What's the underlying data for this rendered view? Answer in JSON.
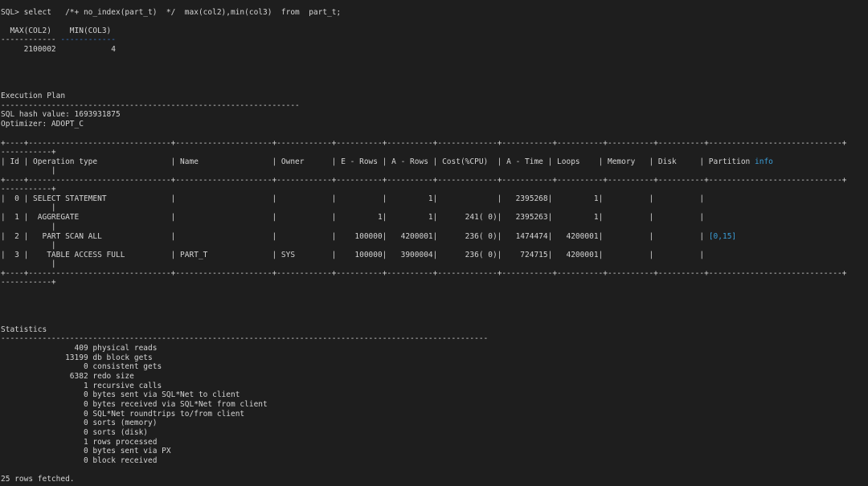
{
  "query": {
    "line": "SQL> select   /*+ no_index(part_t)  */  max(col2),min(col3)  from  part_t;",
    "col_header": "  MAX(COL2)    MIN(COL3)",
    "sep_a": "------------",
    "sep_b": "------------",
    "result": "     2100002            4"
  },
  "plan": {
    "title": "Execution Plan",
    "title_rule": "-----------------------------------------------------------------",
    "hash": "SQL hash value: 1693931875",
    "optimizer": "Optimizer: ADOPT_C",
    "border": "+----+-------------------------------+---------------------+------------+----------+----------+-------------+-----------+----------+----------+----------+-----------------------------+",
    "border_tail": "-----------+",
    "header": "| Id | Operation type                | Name                | Owner      | E - Rows | A - Rows | Cost(%CPU)  | A - Time | Loops    | Memory   | Disk     | Partition ",
    "header_link": "info",
    "wrap_bar": "           |",
    "rows": [
      {
        "text": "|  0 | SELECT STATEMENT              |                     |            |          |         1|             |   2395268|         1|          |          |",
        "link": ""
      },
      {
        "text": "|  1 |  AGGREGATE                    |                     |            |         1|         1|      241( 0)|   2395263|         1|          |          |",
        "link": ""
      },
      {
        "text": "|  2 |   PART SCAN ALL               |                     |            |    100000|   4200001|      236( 0)|   1474474|   4200001|          |          | ",
        "link": "[0,15]"
      },
      {
        "text": "|  3 |    TABLE ACCESS FULL          | PART_T              | SYS        |    100000|   3900004|      236( 0)|    724715|   4200001|          |          |",
        "link": ""
      }
    ]
  },
  "statistics": {
    "title": "Statistics",
    "rule": "----------------------------------------------------------------------------------------------------------",
    "items": [
      "                409 physical reads",
      "              13199 db block gets",
      "                  0 consistent gets",
      "               6382 redo size",
      "                  1 recursive calls",
      "                  0 bytes sent via SQL*Net to client",
      "                  0 bytes received via SQL*Net from client",
      "                  0 SQL*Net roundtrips to/from client",
      "                  0 sorts (memory)",
      "                  0 sorts (disk)",
      "                  1 rows processed",
      "                  0 bytes sent via PX",
      "                  0 block received"
    ]
  },
  "footer": "25 rows fetched."
}
